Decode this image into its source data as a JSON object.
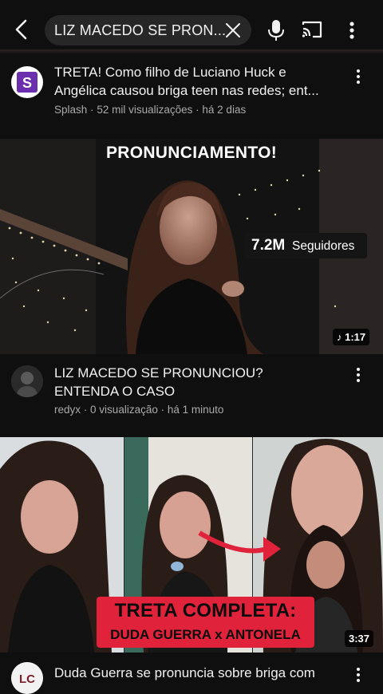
{
  "colors": {
    "background": "#0f0f0f",
    "search_bg": "#272727",
    "accent_red": "#e0223b",
    "meta_text": "#aaaaaa"
  },
  "header": {
    "search_query": "LIZ MACEDO SE PRON...",
    "icons": [
      "back-arrow-icon",
      "clear-icon",
      "microphone-icon",
      "cast-icon",
      "more-vert-icon"
    ]
  },
  "videos": [
    {
      "title_line1": "TRETA! Como filho de Luciano Huck e",
      "title_line2": "Angélica causou briga teen nas redes; ent...",
      "channel": "Splash",
      "views": "52 mil visualizações",
      "age": "há 2 dias",
      "avatar_letter": "S"
    },
    {
      "thumb_headline": "PRONUNCIAMENTO!",
      "followers_number": "7.2M",
      "followers_label": "Seguidores",
      "duration": "1:17",
      "title_line1": "LIZ MACEDO SE PRONUNCIOU?",
      "title_line2": "ENTENDA O CASO",
      "channel": "redyx",
      "views": "0 visualização",
      "age": "há 1 minuto"
    },
    {
      "caption_line1": "TRETA COMPLETA:",
      "caption_line2": "DUDA GUERRA x ANTONELA",
      "duration": "3:37",
      "title_line1": "Duda Guerra se pronuncia sobre briga com",
      "avatar_letter": "LC"
    }
  ],
  "separator": "·"
}
